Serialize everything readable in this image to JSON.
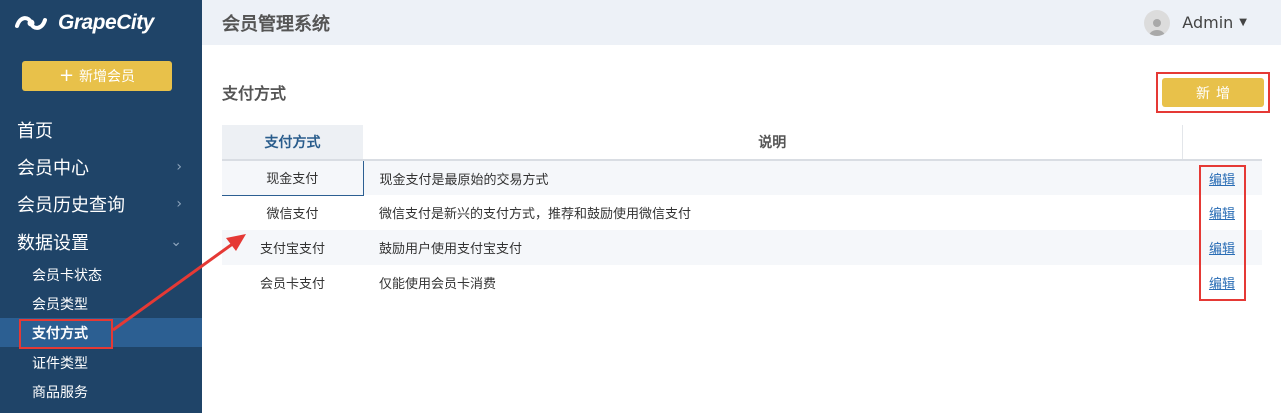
{
  "brand": {
    "name": "GrapeCity",
    "logo_icon": "grapecity-swirl-icon"
  },
  "sidebar": {
    "new_member_label": "新增会员",
    "items": [
      {
        "label": "首页"
      },
      {
        "label": "会员中心",
        "icon": "chevron-right-icon"
      },
      {
        "label": "会员历史查询",
        "icon": "chevron-right-icon"
      },
      {
        "label": "数据设置",
        "icon": "chevron-down-icon"
      }
    ],
    "sub_items": [
      {
        "label": "会员卡状态"
      },
      {
        "label": "会员类型"
      },
      {
        "label": "支付方式",
        "active": true
      },
      {
        "label": "证件类型"
      },
      {
        "label": "商品服务"
      }
    ]
  },
  "header": {
    "title": "会员管理系统",
    "user": "Admin"
  },
  "main": {
    "section_title": "支付方式",
    "add_label": "新增",
    "table": {
      "columns": [
        "支付方式",
        "说明",
        ""
      ],
      "rows": [
        {
          "method": "现金支付",
          "desc": "现金支付是最原始的交易方式",
          "action": "编辑"
        },
        {
          "method": "微信支付",
          "desc": "微信支付是新兴的支付方式，推荐和鼓励使用微信支付",
          "action": "编辑"
        },
        {
          "method": "支付宝支付",
          "desc": "鼓励用户使用支付宝支付",
          "action": "编辑"
        },
        {
          "method": "会员卡支付",
          "desc": "仅能使用会员卡消费",
          "action": "编辑"
        }
      ]
    }
  },
  "colors": {
    "sidebar": "#1f4468",
    "accent": "#e8c14a",
    "highlight": "#e53935",
    "active": "#2c5f92"
  }
}
